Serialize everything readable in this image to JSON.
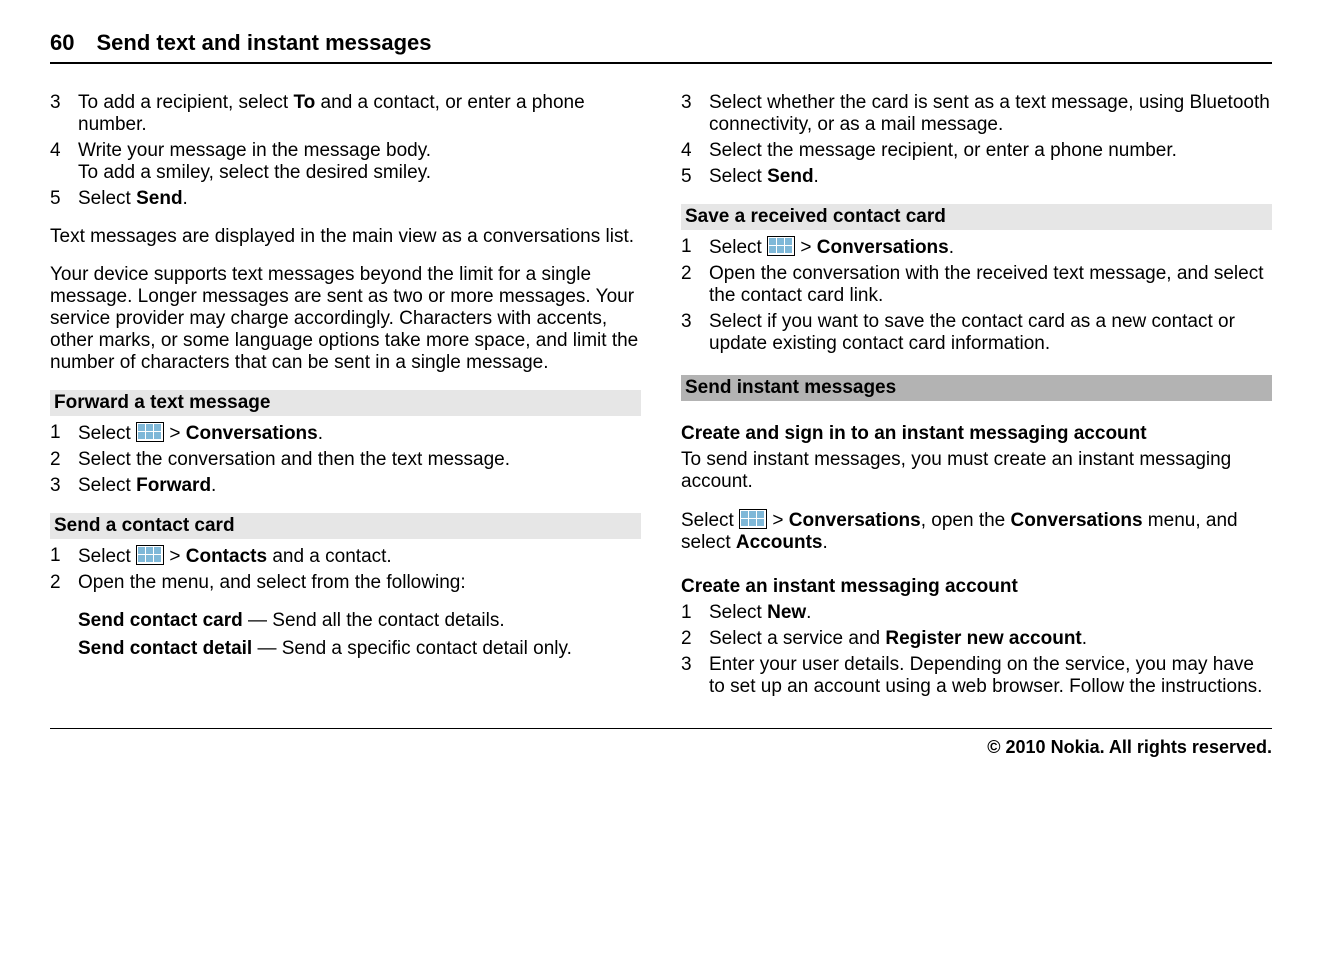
{
  "header": {
    "page_number": "60",
    "title": "Send text and instant messages"
  },
  "left": {
    "steps_a": [
      {
        "num": "3",
        "pre": "To add a recipient, select ",
        "b1": "To",
        "post": " and a contact, or enter a phone number."
      },
      {
        "num": "4",
        "pre": "Write your message in the message body.",
        "extra": "To add a smiley, select the desired smiley."
      },
      {
        "num": "5",
        "pre": "Select ",
        "b1": "Send",
        "post": "."
      }
    ],
    "para1": "Text messages are displayed in the main view as a conversations list.",
    "para2": "Your device supports text messages beyond the limit for a single message. Longer messages are sent as two or more messages. Your service provider may charge accordingly. Characters with accents, other marks, or some language options take more space, and limit the number of characters that can be sent in a single message.",
    "forward_heading": "Forward a text message",
    "forward_steps": [
      {
        "num": "1",
        "pre": "Select ",
        "icon": true,
        "mid": " > ",
        "b1": "Conversations",
        "post": "."
      },
      {
        "num": "2",
        "pre": "Select the conversation and then the text message."
      },
      {
        "num": "3",
        "pre": "Select ",
        "b1": "Forward",
        "post": "."
      }
    ],
    "sendcard_heading": "Send a contact card",
    "sendcard_steps": [
      {
        "num": "1",
        "pre": "Select ",
        "icon": true,
        "mid": " > ",
        "b1": "Contacts",
        "post": " and a contact."
      },
      {
        "num": "2",
        "pre": "Open the menu, and select from the following:"
      }
    ],
    "defs": [
      {
        "term": "Send contact card",
        "desc": " — Send all the contact details."
      },
      {
        "term": "Send contact detail",
        "desc": " — Send a specific contact detail only."
      }
    ]
  },
  "right": {
    "steps_a": [
      {
        "num": "3",
        "pre": "Select whether the card is sent as a text message, using Bluetooth connectivity, or as a mail message."
      },
      {
        "num": "4",
        "pre": "Select the message recipient, or enter a phone number."
      },
      {
        "num": "5",
        "pre": "Select ",
        "b1": "Send",
        "post": "."
      }
    ],
    "save_heading": "Save a received contact card",
    "save_steps": [
      {
        "num": "1",
        "pre": "Select ",
        "icon": true,
        "mid": " > ",
        "b1": "Conversations",
        "post": "."
      },
      {
        "num": "2",
        "pre": "Open the conversation with the received text message, and select the contact card link."
      },
      {
        "num": "3",
        "pre": "Select if you want to save the contact card as a new contact or update existing contact card information."
      }
    ],
    "im_section": "Send instant messages",
    "create_signin_heading": "Create and sign in to an instant messaging account",
    "create_signin_para": "To send instant messages, you must create an instant messaging account.",
    "select_line": {
      "pre": "Select ",
      "icon": true,
      "mid": " > ",
      "b1": "Conversations",
      "mid2": ", open the ",
      "b2": "Conversations",
      "mid3": " menu, and select ",
      "b3": "Accounts",
      "post": "."
    },
    "create_acc_heading": "Create an instant messaging account",
    "create_acc_steps": [
      {
        "num": "1",
        "pre": "Select ",
        "b1": "New",
        "post": "."
      },
      {
        "num": "2",
        "pre": "Select a service and ",
        "b1": "Register new account",
        "post": "."
      },
      {
        "num": "3",
        "pre": "Enter your user details. Depending on the service, you may have to set up an account using a web browser. Follow the instructions."
      }
    ]
  },
  "footer": "© 2010 Nokia. All rights reserved."
}
